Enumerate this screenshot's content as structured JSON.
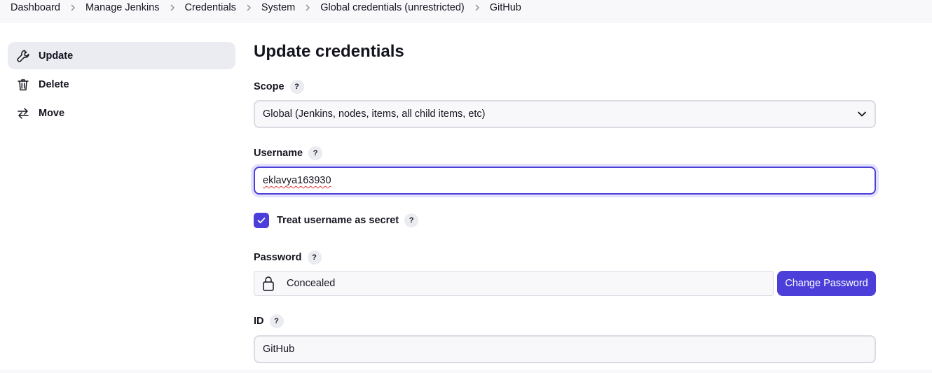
{
  "breadcrumb": {
    "items": [
      "Dashboard",
      "Manage Jenkins",
      "Credentials",
      "System",
      "Global credentials (unrestricted)",
      "GitHub"
    ]
  },
  "sidebar": {
    "items": [
      {
        "label": "Update",
        "icon": "wrench-icon",
        "active": true
      },
      {
        "label": "Delete",
        "icon": "trash-icon",
        "active": false
      },
      {
        "label": "Move",
        "icon": "move-arrows-icon",
        "active": false
      }
    ]
  },
  "main": {
    "title": "Update credentials",
    "scope": {
      "label": "Scope",
      "help": "?",
      "value": "Global (Jenkins, nodes, items, all child items, etc)"
    },
    "username": {
      "label": "Username",
      "help": "?",
      "value": "eklavya163930"
    },
    "treat_secret": {
      "label": "Treat username as secret",
      "help": "?",
      "checked": true
    },
    "password": {
      "label": "Password",
      "help": "?",
      "value": "Concealed",
      "button": "Change Password"
    },
    "id": {
      "label": "ID",
      "help": "?",
      "value": "GitHub"
    }
  },
  "colors": {
    "accent": "#4b3ed9",
    "surface": "#f8f8fb",
    "border": "#dadae3",
    "active_bg": "#ebebf2"
  }
}
